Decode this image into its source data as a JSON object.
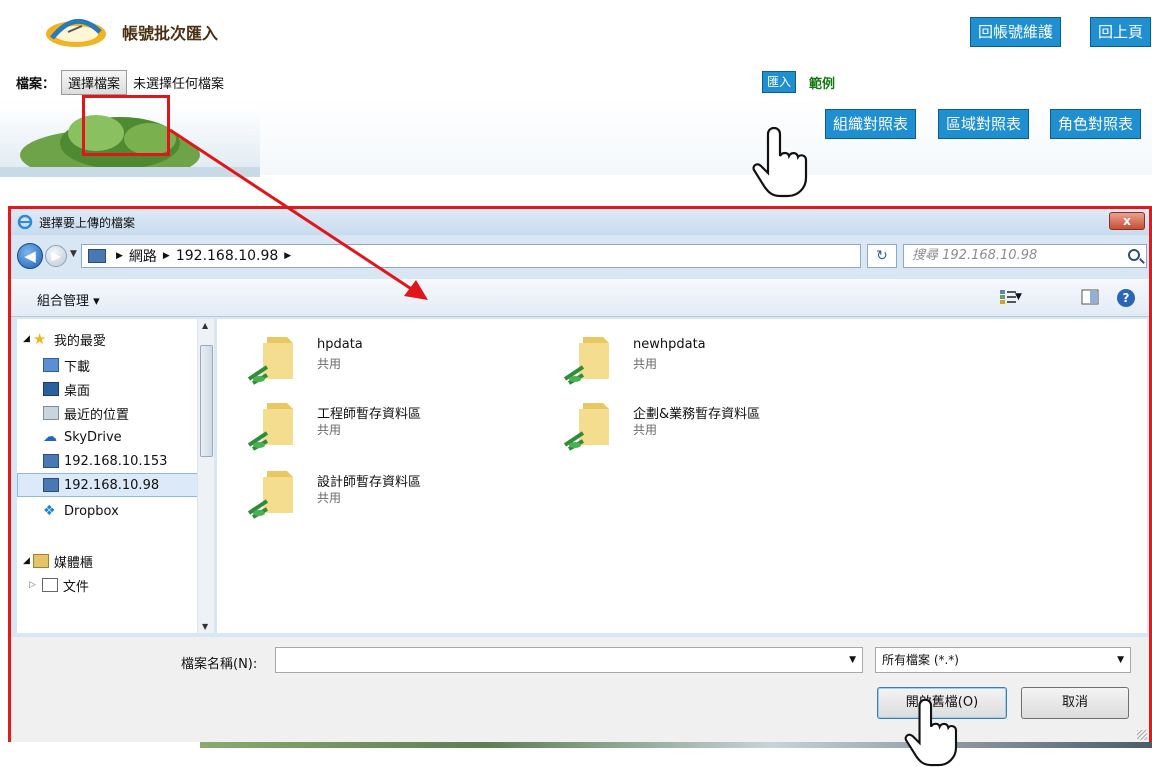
{
  "page": {
    "title": "帳號批次匯入",
    "buttons": {
      "account_maintenance": "回帳號維護",
      "back": "回上頁"
    },
    "file": {
      "label": "檔案：",
      "choose_button": "選擇檔案",
      "no_file": "未選擇任何檔案"
    },
    "import_button": "匯入",
    "sample_link": "範例",
    "mapping_buttons": [
      "組織對照表",
      "區域對照表",
      "角色對照表"
    ]
  },
  "dialog": {
    "title": "選擇要上傳的檔案",
    "close_label": "x",
    "address": {
      "segments": [
        "網路",
        "192.168.10.98"
      ]
    },
    "search_placeholder": "搜尋 192.168.10.98",
    "toolbar": {
      "organize": "組合管理 ▾"
    },
    "nav": {
      "favorites_header": "我的最愛",
      "items": [
        {
          "label": "下載",
          "icon": "download-folder-icon"
        },
        {
          "label": "桌面",
          "icon": "desktop-icon"
        },
        {
          "label": "最近的位置",
          "icon": "recent-places-icon"
        },
        {
          "label": "SkyDrive",
          "icon": "skydrive-icon"
        },
        {
          "label": "192.168.10.153",
          "icon": "network-computer-icon"
        },
        {
          "label": "192.168.10.98",
          "icon": "network-computer-icon",
          "selected": true
        },
        {
          "label": "Dropbox",
          "icon": "dropbox-icon"
        }
      ],
      "libraries_header": "媒體櫃",
      "library_items": [
        {
          "label": "文件",
          "icon": "document-icon"
        }
      ]
    },
    "folders": [
      {
        "name": "hpdata",
        "sub": "共用"
      },
      {
        "name": "newhpdata",
        "sub": "共用"
      },
      {
        "name": "工程師暫存資料區",
        "sub": "共用"
      },
      {
        "name": "企劃&業務暫存資料區",
        "sub": "共用"
      },
      {
        "name": "設計師暫存資料區",
        "sub": "共用"
      }
    ],
    "filename_label": "檔案名稱(N):",
    "filename_value": "",
    "filter_value": "所有檔案 (*.*)",
    "open_button": "開啟舊檔(O)",
    "cancel_button": "取消"
  },
  "colors": {
    "accent_blue": "#1f8fd0",
    "highlight_red": "#e0161a",
    "sample_green": "#147a14"
  }
}
